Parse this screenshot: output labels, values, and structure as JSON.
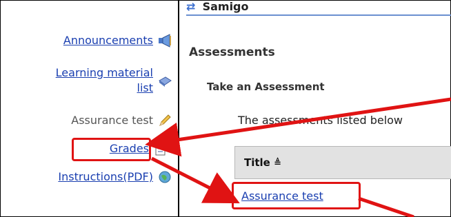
{
  "sidebar": {
    "items": [
      {
        "label": "Announcements",
        "link": true,
        "icon": "megaphone-icon"
      },
      {
        "label_line1": "Learning material",
        "label_line2": "list",
        "link": true,
        "icon": "book-icon"
      },
      {
        "label": "Assurance test",
        "link": false,
        "icon": "pencil-icon"
      },
      {
        "label": "Grades",
        "link": true,
        "icon": "gradebook-icon"
      },
      {
        "label": "Instructions(PDF)",
        "link": true,
        "icon": "globe-icon"
      }
    ]
  },
  "tool": {
    "title": "Samigo",
    "icon": "refresh-arrows-icon"
  },
  "main": {
    "heading": "Assessments",
    "subheading": "Take an Assessment",
    "instructions": "The assessments listed below",
    "table": {
      "column_title": "Title",
      "sort_icon": "sort-ascending-icon",
      "rows": [
        "Assurance test"
      ]
    }
  },
  "colors": {
    "link": "#1a3fb0",
    "highlight": "#e01313",
    "table_header": "#e2e2e2"
  }
}
